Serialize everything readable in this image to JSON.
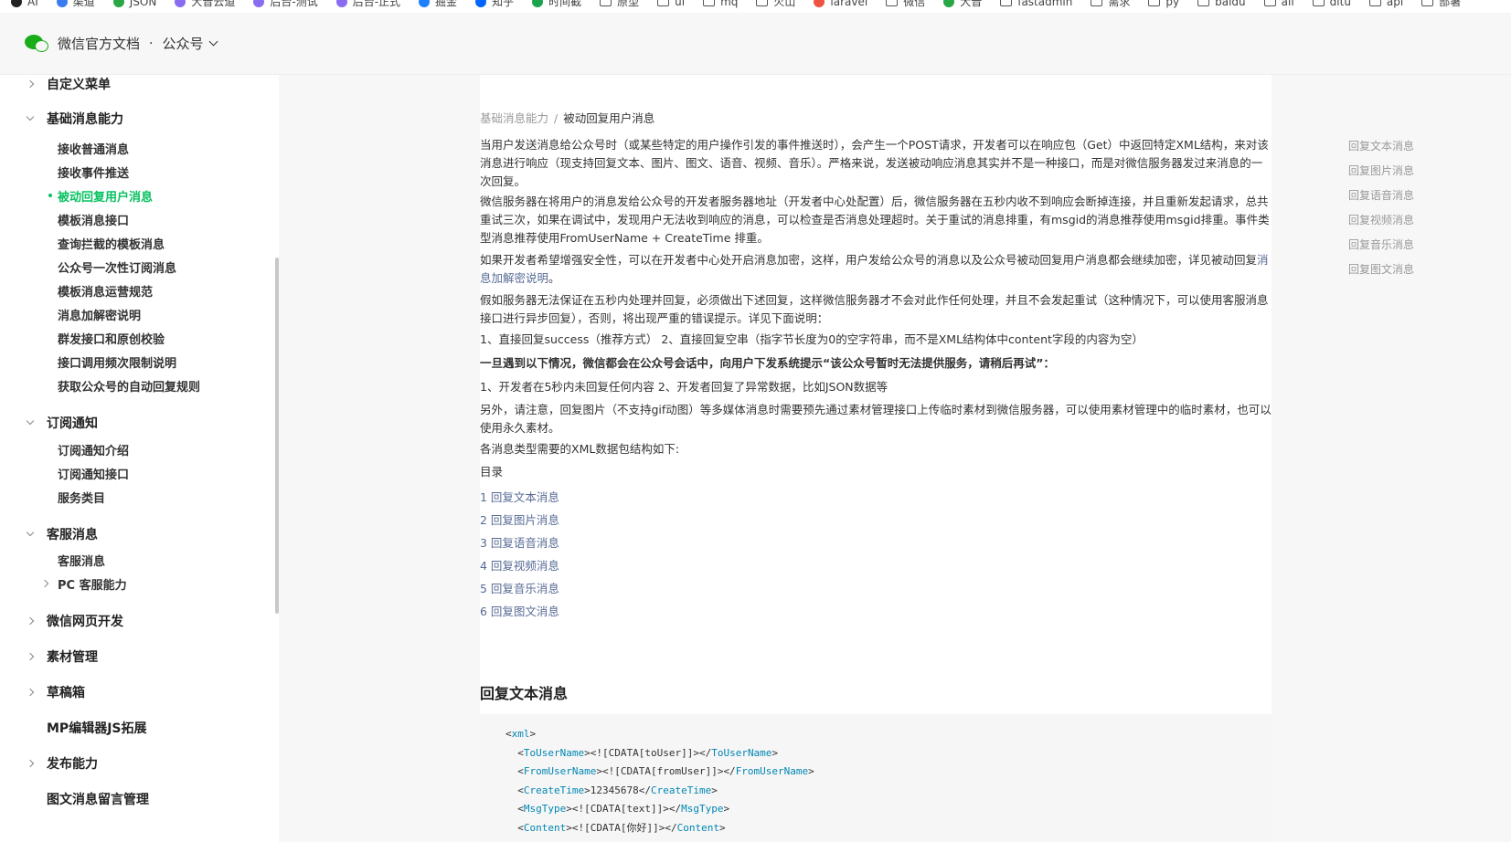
{
  "bookmarks": [
    {
      "label": "AI",
      "icon": "ai-logo-icon",
      "color": "#222222"
    },
    {
      "label": "渠道",
      "icon": "bookmark-logo-icon",
      "color": "#3b7cf0"
    },
    {
      "label": "JSON",
      "icon": "json-logo-icon",
      "color": "#2aa745"
    },
    {
      "label": "大音云道",
      "icon": "purple-logo-icon",
      "color": "#8a6cf2"
    },
    {
      "label": "后台-测试",
      "icon": "purple-logo-icon",
      "color": "#8a6cf2"
    },
    {
      "label": "后台-正式",
      "icon": "purple-logo-icon",
      "color": "#8a6cf2"
    },
    {
      "label": "掘金",
      "icon": "juejin-logo-icon",
      "color": "#1e80ff"
    },
    {
      "label": "知乎",
      "icon": "zhihu-logo-icon",
      "color": "#0066ff"
    },
    {
      "label": "时间截",
      "icon": "green-logo-icon",
      "color": "#1aa34a"
    },
    {
      "label": "原型",
      "icon": "folder-icon",
      "color": ""
    },
    {
      "label": "ui",
      "icon": "folder-icon",
      "color": ""
    },
    {
      "label": "mq",
      "icon": "folder-icon",
      "color": ""
    },
    {
      "label": "火山",
      "icon": "folder-icon",
      "color": ""
    },
    {
      "label": "laravel",
      "icon": "laravel-logo-icon",
      "color": "#f05340"
    },
    {
      "label": "微信",
      "icon": "folder-icon",
      "color": ""
    },
    {
      "label": "大音",
      "icon": "green-logo-icon",
      "color": "#2aa745"
    },
    {
      "label": "fastadmin",
      "icon": "folder-icon",
      "color": ""
    },
    {
      "label": "需求",
      "icon": "folder-icon",
      "color": ""
    },
    {
      "label": "py",
      "icon": "folder-icon",
      "color": ""
    },
    {
      "label": "baidu",
      "icon": "folder-icon",
      "color": ""
    },
    {
      "label": "ali",
      "icon": "folder-icon",
      "color": ""
    },
    {
      "label": "ditu",
      "icon": "folder-icon",
      "color": ""
    },
    {
      "label": "api",
      "icon": "folder-icon",
      "color": ""
    },
    {
      "label": "部署",
      "icon": "folder-icon",
      "color": ""
    }
  ],
  "header": {
    "site_title": "微信官方文档",
    "dot": "·",
    "product": "公众号"
  },
  "sidebar": {
    "items": [
      {
        "label": "自定义菜单",
        "level": "group",
        "caret": "right"
      },
      {
        "label": "基础消息能力",
        "level": "group",
        "caret": "down"
      },
      {
        "label": "接收普通消息",
        "level": "child",
        "caret": ""
      },
      {
        "label": "接收事件推送",
        "level": "child",
        "caret": ""
      },
      {
        "label": "被动回复用户消息",
        "level": "child",
        "caret": "",
        "active": true
      },
      {
        "label": "模板消息接口",
        "level": "child",
        "caret": ""
      },
      {
        "label": "查询拦截的模板消息",
        "level": "child",
        "caret": ""
      },
      {
        "label": "公众号一次性订阅消息",
        "level": "child",
        "caret": ""
      },
      {
        "label": "模板消息运营规范",
        "level": "child",
        "caret": ""
      },
      {
        "label": "消息加解密说明",
        "level": "child",
        "caret": ""
      },
      {
        "label": "群发接口和原创校验",
        "level": "child",
        "caret": ""
      },
      {
        "label": "接口调用频次限制说明",
        "level": "child",
        "caret": ""
      },
      {
        "label": "获取公众号的自动回复规则",
        "level": "child",
        "caret": ""
      },
      {
        "label": "订阅通知",
        "level": "group",
        "caret": "down"
      },
      {
        "label": "订阅通知介绍",
        "level": "child",
        "caret": ""
      },
      {
        "label": "订阅通知接口",
        "level": "child",
        "caret": ""
      },
      {
        "label": "服务类目",
        "level": "child",
        "caret": ""
      },
      {
        "label": "客服消息",
        "level": "group",
        "caret": "down"
      },
      {
        "label": "客服消息",
        "level": "child",
        "caret": ""
      },
      {
        "label": "PC 客服能力",
        "level": "child",
        "caret": "right"
      },
      {
        "label": "微信网页开发",
        "level": "group",
        "caret": "right"
      },
      {
        "label": "素材管理",
        "level": "group",
        "caret": "right"
      },
      {
        "label": "草稿箱",
        "level": "group",
        "caret": "right"
      },
      {
        "label": "MP编辑器JS拓展",
        "level": "group",
        "caret": ""
      },
      {
        "label": "发布能力",
        "level": "group",
        "caret": "right"
      },
      {
        "label": "图文消息留言管理",
        "level": "group",
        "caret": ""
      }
    ]
  },
  "breadcrumb": {
    "parent": "基础消息能力",
    "sep": "/",
    "current": "被动回复用户消息"
  },
  "content": {
    "p1": "当用户发送消息给公众号时（或某些特定的用户操作引发的事件推送时），会产生一个POST请求，开发者可以在响应包（Get）中返回特定XML结构，来对该消息进行响应（现支持回复文本、图片、图文、语音、视频、音乐）。严格来说，发送被动响应消息其实并不是一种接口，而是对微信服务器发过来消息的一次回复。",
    "p2": "微信服务器在将用户的消息发给公众号的开发者服务器地址（开发者中心处配置）后，微信服务器在五秒内收不到响应会断掉连接，并且重新发起请求，总共重试三次，如果在调试中，发现用户无法收到响应的消息，可以检查是否消息处理超时。关于重试的消息排重，有msgid的消息推荐使用msgid排重。事件类型消息推荐使用FromUserName + CreateTime 排重。",
    "p3_text": "如果开发者希望增强安全性，可以在开发者中心处开启消息加密，这样，用户发给公众号的消息以及公众号被动回复用户消息都会继续加密，详见被动回复",
    "p3_link": "消息加解密说明",
    "p3_end": "。",
    "p4": "假如服务器无法保证在五秒内处理并回复，必须做出下述回复，这样微信服务器才不会对此作任何处理，并且不会发起重试（这种情况下，可以使用客服消息接口进行异步回复），否则，将出现严重的错误提示。详见下面说明：",
    "p5": "1、直接回复success（推荐方式） 2、直接回复空串（指字节长度为0的空字符串，而不是XML结构体中content字段的内容为空）",
    "p6": "一旦遇到以下情况，微信都会在公众号会话中，向用户下发系统提示“该公众号暂时无法提供服务，请稍后再试”：",
    "p7": "1、开发者在5秒内未回复任何内容 2、开发者回复了异常数据，比如JSON数据等",
    "p8": "另外，请注意，回复图片（不支持gif动图）等多媒体消息时需要预先通过素材管理接口上传临时素材到微信服务器，可以使用素材管理中的临时素材，也可以使用永久素材。",
    "p9": "各消息类型需要的XML数据包结构如下:",
    "toc_title": "目录",
    "toc": [
      "1 回复文本消息",
      "2 回复图片消息",
      "3 回复语音消息",
      "4 回复视频消息",
      "5 回复音乐消息",
      "6 回复图文消息"
    ],
    "section_title": "回复文本消息",
    "code_lines": [
      {
        "indent": "",
        "open": "xml",
        "text": "",
        "close": ""
      },
      {
        "indent": "  ",
        "open": "ToUserName",
        "text": "<![CDATA[toUser]]>",
        "close": "ToUserName"
      },
      {
        "indent": "  ",
        "open": "FromUserName",
        "text": "<![CDATA[fromUser]]>",
        "close": "FromUserName"
      },
      {
        "indent": "  ",
        "open": "CreateTime",
        "text": "12345678",
        "close": "CreateTime"
      },
      {
        "indent": "  ",
        "open": "MsgType",
        "text": "<![CDATA[text]]>",
        "close": "MsgType"
      },
      {
        "indent": "  ",
        "open": "Content",
        "text": "<![CDATA[你好]]>",
        "close": "Content"
      }
    ]
  },
  "right_toc": [
    "回复文本消息",
    "回复图片消息",
    "回复语音消息",
    "回复视频消息",
    "回复音乐消息",
    "回复图文消息"
  ],
  "colors": {
    "accent": "#07c160",
    "link": "#576b95",
    "code_tag": "#0086b3"
  }
}
